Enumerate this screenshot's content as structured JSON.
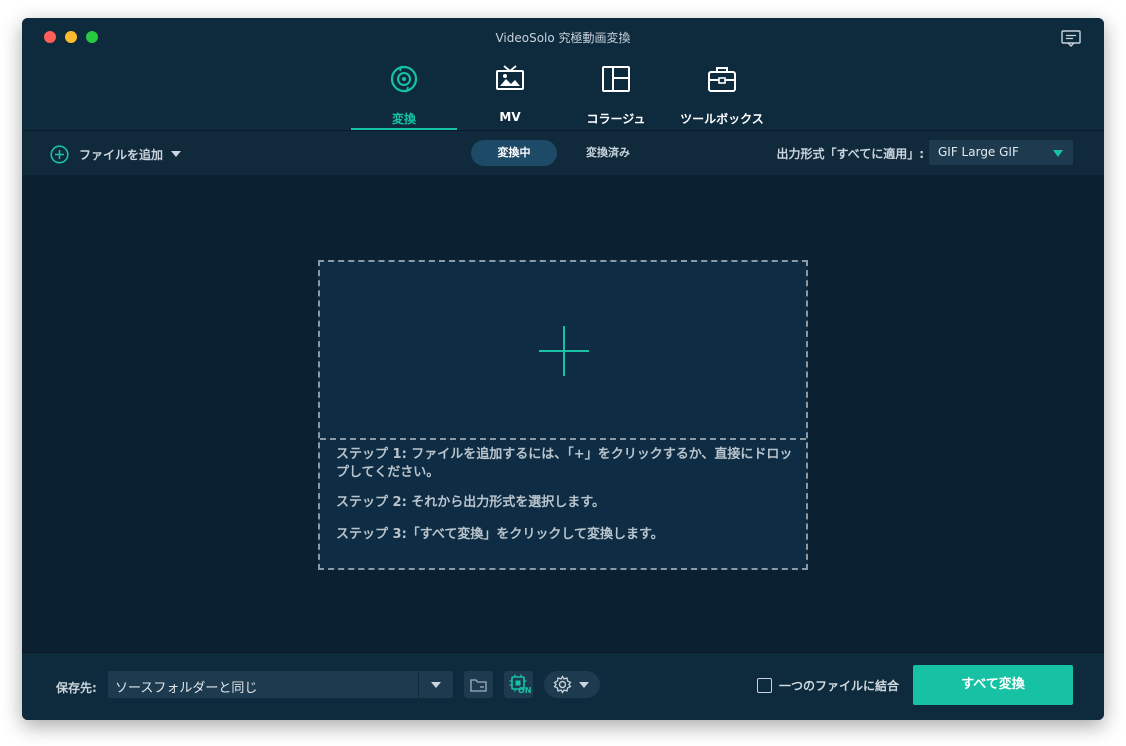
{
  "window": {
    "title": "VideoSolo 究極動画変換"
  },
  "tabs": [
    {
      "label": "変換",
      "icon": "convert-icon",
      "active": true
    },
    {
      "label": "MV",
      "icon": "mv-icon",
      "active": false
    },
    {
      "label": "コラージュ",
      "icon": "collage-icon",
      "active": false
    },
    {
      "label": "ツールボックス",
      "icon": "toolbox-icon",
      "active": false
    }
  ],
  "toolbar": {
    "add_file_label": "ファイルを追加",
    "segments": [
      {
        "label": "変換中",
        "active": true
      },
      {
        "label": "変換済み",
        "active": false
      }
    ],
    "output_format_label": "出力形式「すべてに適用」:",
    "output_format_value": "GIF Large GIF"
  },
  "dropzone": {
    "step1": "ステップ 1: ファイルを追加するには、「+」をクリックするか、直接にドロップしてください。",
    "step2": "ステップ 2: それから出力形式を選択します。",
    "step3": "ステップ 3:「すべて変換」をクリックして変換します。"
  },
  "footer": {
    "save_label": "保存先:",
    "save_path": "ソースフォルダーと同じ",
    "hw_accel_badge": "ON",
    "merge_label": "一つのファイルに結合",
    "convert_all_label": "すべて変換"
  },
  "colors": {
    "accent": "#17c2a4",
    "background": "#0b2131",
    "header": "#0e2a3d"
  }
}
